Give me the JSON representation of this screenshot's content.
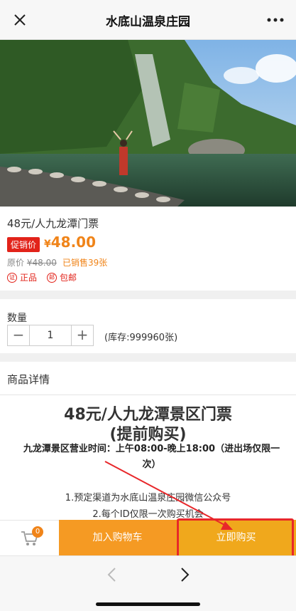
{
  "header": {
    "title": "水底山温泉庄园"
  },
  "product": {
    "name": "48元/人九龙潭门票",
    "promo_tag": "促销价",
    "currency": "¥",
    "price": "48.00",
    "orig_label": "原价",
    "orig_price": "¥48.00",
    "sold": "已销售39张",
    "guarantee_1": "正品",
    "guarantee_2": "包邮",
    "guarantee_1_icon_text": "证",
    "guarantee_2_icon_text": "邮"
  },
  "quantity": {
    "label": "数量",
    "minus": "−",
    "value": "1",
    "plus": "+",
    "stock": "(库存:999960张)"
  },
  "detail": {
    "header": "商品详情",
    "title": "48元/人九龙潭景区门票",
    "subtitle": "(提前购买)",
    "hours": "九龙潭景区营业时间：上午08:00-晚上18:00（进出场仅限一次）",
    "rule_1": "1.预定渠道为水底山温泉庄园微信公众号",
    "rule_2": "2.每个ID仅限一次购买机会"
  },
  "bottom_bar": {
    "cart_count": "0",
    "add_to_cart": "加入购物车",
    "buy_now": "立即购买"
  },
  "colors": {
    "accent_orange": "#f59a23",
    "buy_orange": "#f0a81c",
    "promo_red": "#e2231a",
    "annotation_red": "#e8272a"
  }
}
